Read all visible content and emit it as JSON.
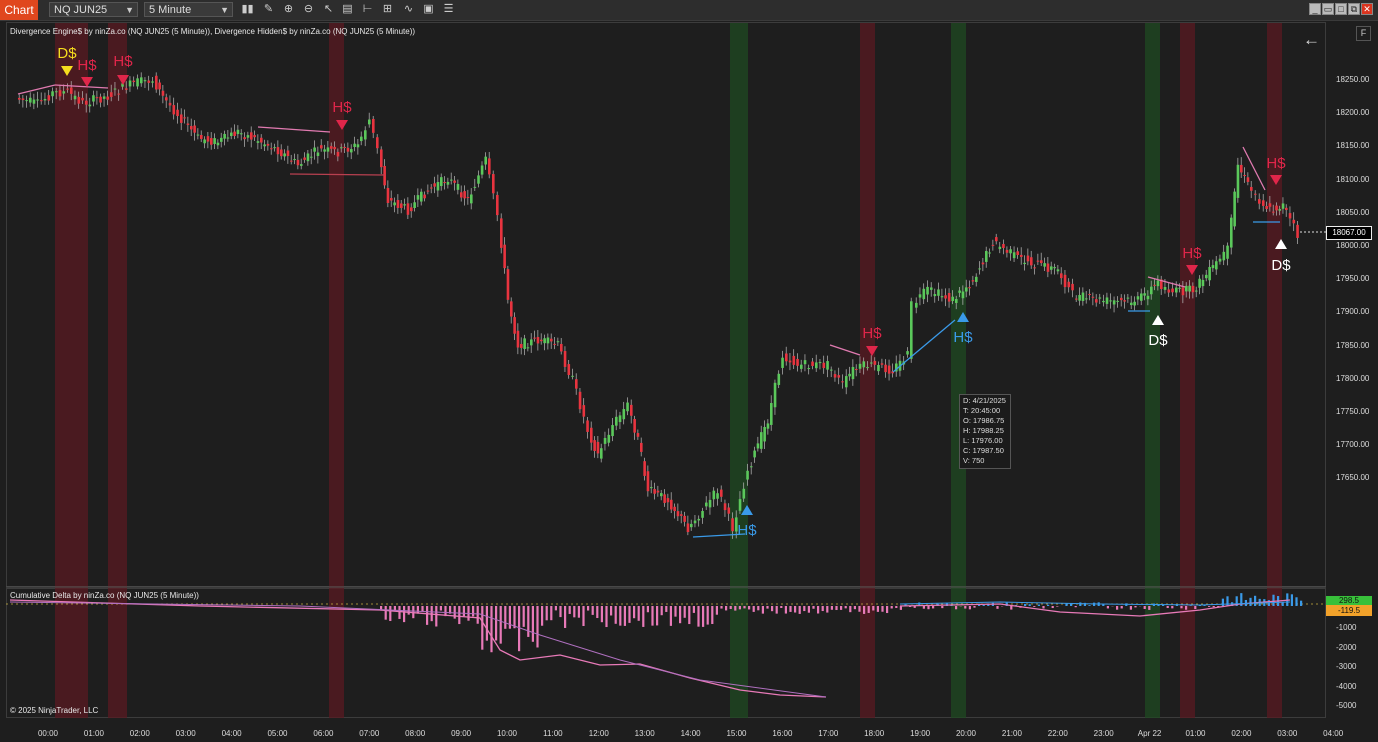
{
  "toolbar": {
    "tab_label": "Chart",
    "instrument": "NQ JUN25",
    "interval": "5 Minute",
    "icons": [
      "bars-type-icon",
      "draw-tool-icon",
      "zoom-in-icon",
      "zoom-out-icon",
      "pointer-icon",
      "properties-icon",
      "strategy-icon",
      "data-box-icon",
      "indicator-icon",
      "template-icon",
      "list-icon"
    ]
  },
  "window_buttons": [
    "minimize-icon",
    "restore-icon",
    "maximize-icon",
    "close-icon"
  ],
  "main_panel": {
    "indicator_title": "Divergence Engine$ by ninZa.co (NQ JUN25 (5 Minute)), Divergence Hidden$ by ninZa.co (NQ JUN25 (5 Minute))",
    "back_button": "←",
    "f_button": "F",
    "last_price": "18067.00",
    "y_ticks": [
      "18250.00",
      "18200.00",
      "18150.00",
      "18100.00",
      "18050.00",
      "18000.00",
      "17950.00",
      "17900.00",
      "17850.00",
      "17800.00",
      "17750.00",
      "17700.00",
      "17650.00"
    ]
  },
  "tooltip": [
    "D:  4/21/2025",
    "T:  20:45:00",
    "O:  17986.75",
    "H:  17988.25",
    "L:  17976.00",
    "C:  17987.50",
    "V:  750"
  ],
  "signals": [
    {
      "label": "D$",
      "color": "#f5dd1e"
    },
    {
      "label": "H$",
      "color": "#e0264a"
    },
    {
      "label": "H$",
      "color": "#e0264a"
    },
    {
      "label": "H$",
      "color": "#e0264a"
    },
    {
      "label": "H$",
      "color": "#3a9ae8"
    },
    {
      "label": "H$",
      "color": "#e0264a"
    },
    {
      "label": "H$",
      "color": "#3a9ae8"
    },
    {
      "label": "D$",
      "color": "#ffffff"
    },
    {
      "label": "H$",
      "color": "#e0264a"
    },
    {
      "label": "H$",
      "color": "#e0264a"
    },
    {
      "label": "D$",
      "color": "#ffffff"
    }
  ],
  "sub_panel": {
    "title": "Cumulative Delta by ninZa.co (NQ JUN25 (5 Minute))",
    "badge_top": "298.5",
    "badge_bottom": "-119.5",
    "y_ticks": [
      "-1000",
      "-2000",
      "-3000",
      "-4000",
      "-5000"
    ]
  },
  "x_axis": [
    "00:00",
    "01:00",
    "02:00",
    "03:00",
    "04:00",
    "05:00",
    "06:00",
    "07:00",
    "08:00",
    "09:00",
    "10:00",
    "11:00",
    "12:00",
    "13:00",
    "14:00",
    "15:00",
    "16:00",
    "17:00",
    "18:00",
    "19:00",
    "20:00",
    "21:00",
    "22:00",
    "23:00",
    "Apr 22",
    "01:00",
    "02:00",
    "03:00",
    "04:00"
  ],
  "copyright": "© 2025 NinjaTrader, LLC",
  "colors": {
    "up": "#5bc85b",
    "down": "#e8343f",
    "red_band": "#5a1a22",
    "green_band": "#1f4a22",
    "accent": "#e0471e"
  }
}
